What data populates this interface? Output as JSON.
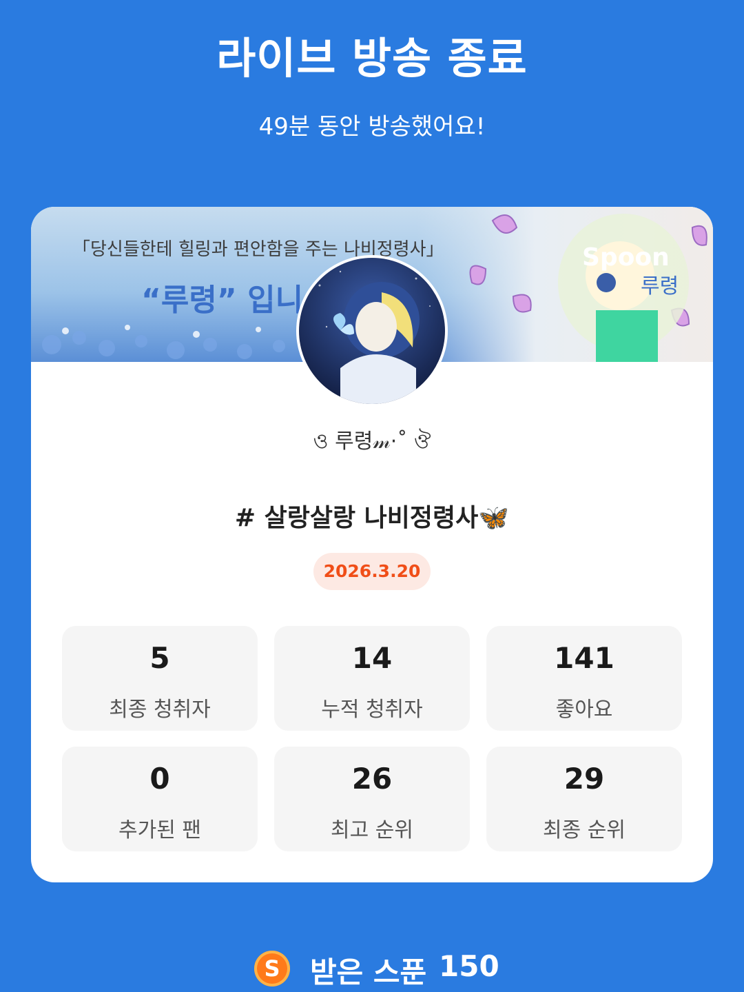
{
  "header": {
    "title": "라이브 방송 종료",
    "subtitle": "49분 동안 방송했어요!"
  },
  "banner": {
    "line1": "「당신들한테 힐링과 편안함을 주는 나비정령사」",
    "line2": "“루령” 입니",
    "logo": "Spoon",
    "side_text": "루령"
  },
  "profile": {
    "nickname": "ও 루령𝓂·˚ ঔ"
  },
  "broadcast": {
    "title": "# 살랑살랑 나비정령사🦋",
    "date": "2026.3.20"
  },
  "stats": [
    {
      "value": "5",
      "label": "최종 청취자"
    },
    {
      "value": "14",
      "label": "누적 청취자"
    },
    {
      "value": "141",
      "label": "좋아요"
    },
    {
      "value": "0",
      "label": "추가된 팬"
    },
    {
      "value": "26",
      "label": "최고 순위"
    },
    {
      "value": "29",
      "label": "최종 순위"
    }
  ],
  "spoons": {
    "coin_letter": "S",
    "label": "받은 스푼",
    "count": "150"
  },
  "colors": {
    "background": "#2a7be0",
    "badge_text": "#f04e18",
    "badge_bg": "#fde9e3",
    "coin": "#ff7a1a"
  }
}
